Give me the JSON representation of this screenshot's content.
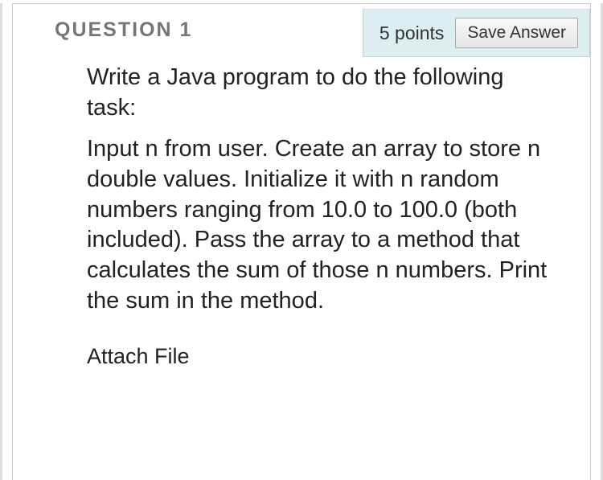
{
  "header": {
    "question_label": "QUESTION 1",
    "points_label": "5 points",
    "save_button_label": "Save Answer"
  },
  "body": {
    "intro": "Write a Java program to do the following task:",
    "task": "Input n from user. Create an array to store n double values. Initialize it with n random numbers ranging from 10.0 to 100.0 (both included). Pass the array to a method that calculates the sum of those n numbers. Print the sum in the method."
  },
  "footer": {
    "attach_label": "Attach File"
  }
}
